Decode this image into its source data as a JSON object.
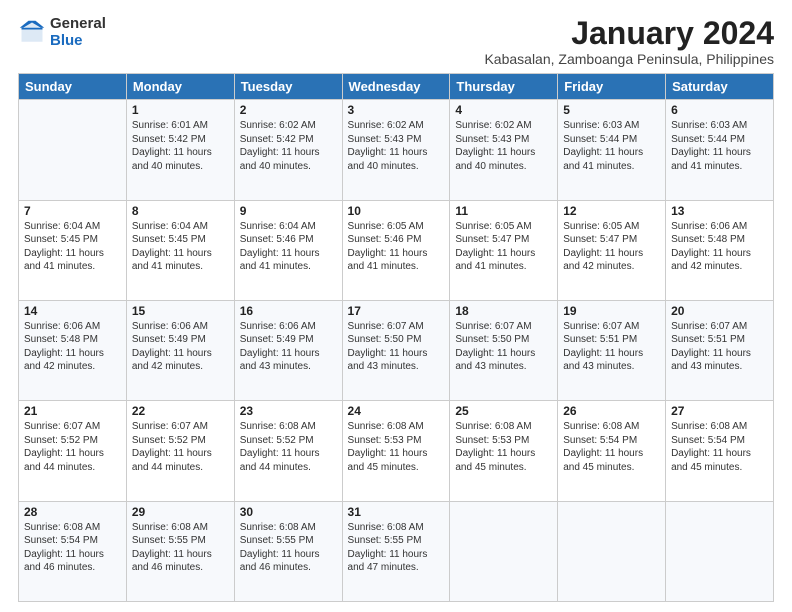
{
  "logo": {
    "general": "General",
    "blue": "Blue"
  },
  "header": {
    "month": "January 2024",
    "location": "Kabasalan, Zamboanga Peninsula, Philippines"
  },
  "weekdays": [
    "Sunday",
    "Monday",
    "Tuesday",
    "Wednesday",
    "Thursday",
    "Friday",
    "Saturday"
  ],
  "weeks": [
    [
      {
        "day": "",
        "info": ""
      },
      {
        "day": "1",
        "info": "Sunrise: 6:01 AM\nSunset: 5:42 PM\nDaylight: 11 hours\nand 40 minutes."
      },
      {
        "day": "2",
        "info": "Sunrise: 6:02 AM\nSunset: 5:42 PM\nDaylight: 11 hours\nand 40 minutes."
      },
      {
        "day": "3",
        "info": "Sunrise: 6:02 AM\nSunset: 5:43 PM\nDaylight: 11 hours\nand 40 minutes."
      },
      {
        "day": "4",
        "info": "Sunrise: 6:02 AM\nSunset: 5:43 PM\nDaylight: 11 hours\nand 40 minutes."
      },
      {
        "day": "5",
        "info": "Sunrise: 6:03 AM\nSunset: 5:44 PM\nDaylight: 11 hours\nand 41 minutes."
      },
      {
        "day": "6",
        "info": "Sunrise: 6:03 AM\nSunset: 5:44 PM\nDaylight: 11 hours\nand 41 minutes."
      }
    ],
    [
      {
        "day": "7",
        "info": "Sunrise: 6:04 AM\nSunset: 5:45 PM\nDaylight: 11 hours\nand 41 minutes."
      },
      {
        "day": "8",
        "info": "Sunrise: 6:04 AM\nSunset: 5:45 PM\nDaylight: 11 hours\nand 41 minutes."
      },
      {
        "day": "9",
        "info": "Sunrise: 6:04 AM\nSunset: 5:46 PM\nDaylight: 11 hours\nand 41 minutes."
      },
      {
        "day": "10",
        "info": "Sunrise: 6:05 AM\nSunset: 5:46 PM\nDaylight: 11 hours\nand 41 minutes."
      },
      {
        "day": "11",
        "info": "Sunrise: 6:05 AM\nSunset: 5:47 PM\nDaylight: 11 hours\nand 41 minutes."
      },
      {
        "day": "12",
        "info": "Sunrise: 6:05 AM\nSunset: 5:47 PM\nDaylight: 11 hours\nand 42 minutes."
      },
      {
        "day": "13",
        "info": "Sunrise: 6:06 AM\nSunset: 5:48 PM\nDaylight: 11 hours\nand 42 minutes."
      }
    ],
    [
      {
        "day": "14",
        "info": "Sunrise: 6:06 AM\nSunset: 5:48 PM\nDaylight: 11 hours\nand 42 minutes."
      },
      {
        "day": "15",
        "info": "Sunrise: 6:06 AM\nSunset: 5:49 PM\nDaylight: 11 hours\nand 42 minutes."
      },
      {
        "day": "16",
        "info": "Sunrise: 6:06 AM\nSunset: 5:49 PM\nDaylight: 11 hours\nand 43 minutes."
      },
      {
        "day": "17",
        "info": "Sunrise: 6:07 AM\nSunset: 5:50 PM\nDaylight: 11 hours\nand 43 minutes."
      },
      {
        "day": "18",
        "info": "Sunrise: 6:07 AM\nSunset: 5:50 PM\nDaylight: 11 hours\nand 43 minutes."
      },
      {
        "day": "19",
        "info": "Sunrise: 6:07 AM\nSunset: 5:51 PM\nDaylight: 11 hours\nand 43 minutes."
      },
      {
        "day": "20",
        "info": "Sunrise: 6:07 AM\nSunset: 5:51 PM\nDaylight: 11 hours\nand 43 minutes."
      }
    ],
    [
      {
        "day": "21",
        "info": "Sunrise: 6:07 AM\nSunset: 5:52 PM\nDaylight: 11 hours\nand 44 minutes."
      },
      {
        "day": "22",
        "info": "Sunrise: 6:07 AM\nSunset: 5:52 PM\nDaylight: 11 hours\nand 44 minutes."
      },
      {
        "day": "23",
        "info": "Sunrise: 6:08 AM\nSunset: 5:52 PM\nDaylight: 11 hours\nand 44 minutes."
      },
      {
        "day": "24",
        "info": "Sunrise: 6:08 AM\nSunset: 5:53 PM\nDaylight: 11 hours\nand 45 minutes."
      },
      {
        "day": "25",
        "info": "Sunrise: 6:08 AM\nSunset: 5:53 PM\nDaylight: 11 hours\nand 45 minutes."
      },
      {
        "day": "26",
        "info": "Sunrise: 6:08 AM\nSunset: 5:54 PM\nDaylight: 11 hours\nand 45 minutes."
      },
      {
        "day": "27",
        "info": "Sunrise: 6:08 AM\nSunset: 5:54 PM\nDaylight: 11 hours\nand 45 minutes."
      }
    ],
    [
      {
        "day": "28",
        "info": "Sunrise: 6:08 AM\nSunset: 5:54 PM\nDaylight: 11 hours\nand 46 minutes."
      },
      {
        "day": "29",
        "info": "Sunrise: 6:08 AM\nSunset: 5:55 PM\nDaylight: 11 hours\nand 46 minutes."
      },
      {
        "day": "30",
        "info": "Sunrise: 6:08 AM\nSunset: 5:55 PM\nDaylight: 11 hours\nand 46 minutes."
      },
      {
        "day": "31",
        "info": "Sunrise: 6:08 AM\nSunset: 5:55 PM\nDaylight: 11 hours\nand 47 minutes."
      },
      {
        "day": "",
        "info": ""
      },
      {
        "day": "",
        "info": ""
      },
      {
        "day": "",
        "info": ""
      }
    ]
  ]
}
